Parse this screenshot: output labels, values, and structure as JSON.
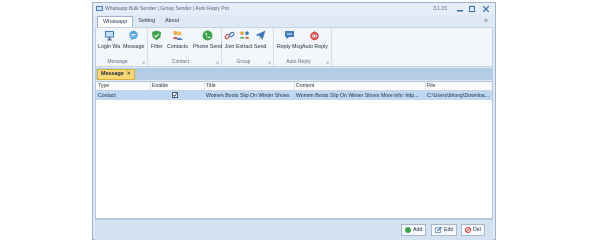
{
  "window": {
    "title": "Whatsapp Bulk Sender | Group Sender | Auto Reply Pro",
    "version": "3.1.15"
  },
  "tabs": [
    "Whatsapp",
    "Setting",
    "About"
  ],
  "ribbon": {
    "groups": [
      {
        "label": "Message",
        "buttons": [
          "Login Wa",
          "Message"
        ]
      },
      {
        "label": "Contact",
        "buttons": [
          "Filter",
          "Contacts",
          "Phone Send"
        ]
      },
      {
        "label": "Group",
        "buttons": [
          "Join",
          "Extract",
          "Send"
        ]
      },
      {
        "label": "Auto Reply",
        "buttons": [
          "Reply Msg",
          "Auto Reply"
        ]
      }
    ]
  },
  "doc_tab": {
    "label": "Message",
    "close": "✕"
  },
  "grid": {
    "columns": [
      "Type",
      "Enable",
      "Title",
      "Content",
      "File"
    ],
    "rows": [
      {
        "type": "Contact",
        "enable": true,
        "title": "Women Boots Slip On Winter Shoes",
        "content": "Women Boots Slip On Winter Shoes More info: http...",
        "file": "C:\\Users\\bhong\\Downloa..."
      }
    ]
  },
  "footer": {
    "add": "Add",
    "edit": "Edit",
    "del": "Del"
  },
  "colors": {
    "accent": "#2f6fb5",
    "selection": "#bfd7f3",
    "doc_tab": "#f8d775"
  }
}
